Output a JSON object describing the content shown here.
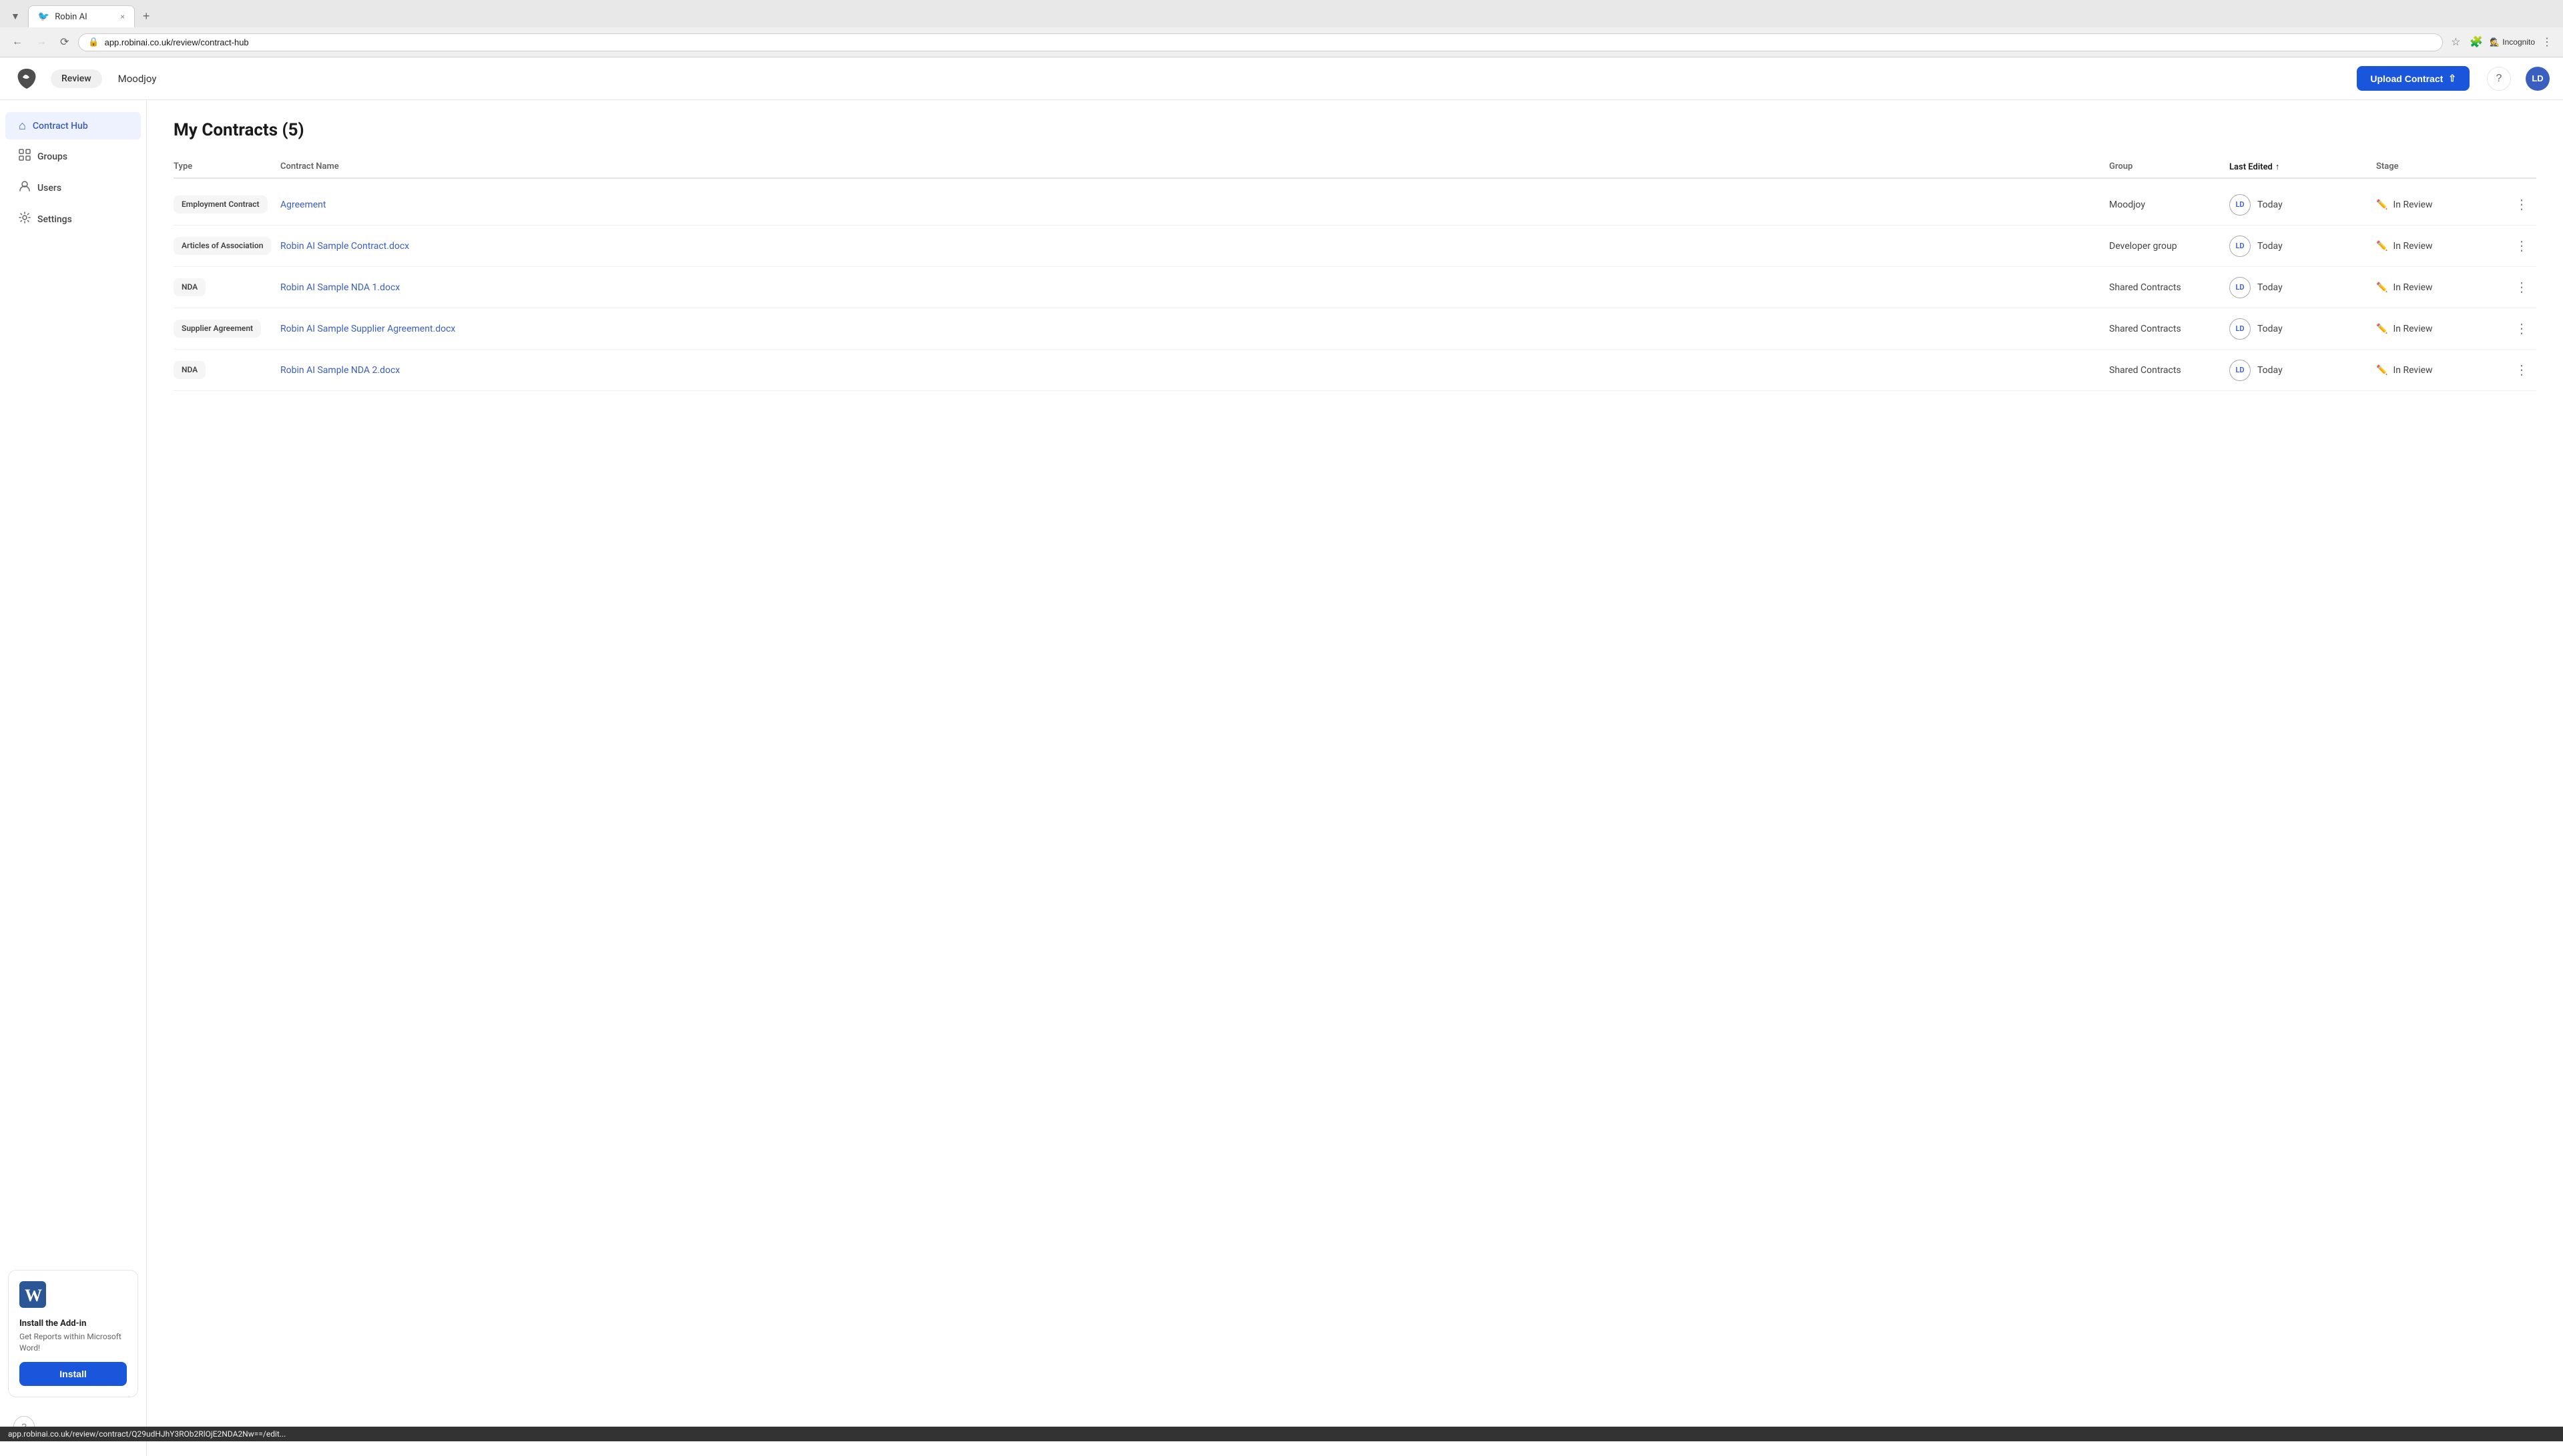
{
  "browser": {
    "tab_label": "Robin AI",
    "tab_close": "×",
    "new_tab": "+",
    "url": "app.robinai.co.uk/review/contract-hub",
    "incognito_label": "Incognito",
    "back_disabled": false,
    "forward_disabled": true
  },
  "header": {
    "review_badge": "Review",
    "org_name": "Moodjoy",
    "upload_button": "Upload Contract",
    "help_icon": "?",
    "avatar_initials": "LD"
  },
  "sidebar": {
    "items": [
      {
        "id": "contract-hub",
        "label": "Contract Hub",
        "active": true
      },
      {
        "id": "groups",
        "label": "Groups",
        "active": false
      },
      {
        "id": "users",
        "label": "Users",
        "active": false
      },
      {
        "id": "settings",
        "label": "Settings",
        "active": false
      }
    ],
    "install_card": {
      "title": "Install the Add-in",
      "description": "Get Reports within Microsoft Word!",
      "button_label": "Install"
    }
  },
  "main": {
    "page_title": "My Contracts (5)",
    "table": {
      "columns": [
        "Type",
        "Contract Name",
        "Group",
        "Last Edited",
        "Stage"
      ],
      "sort_column": "Last Edited",
      "rows": [
        {
          "type": "Employment Contract",
          "name": "Agreement",
          "group": "Moodjoy",
          "avatar": "LD",
          "edited": "Today",
          "stage": "In Review",
          "link": "app.robinai.co.uk/review/contract/Q29udHJhY3ROb2RlOjE2NDA2Nw==/edit..."
        },
        {
          "type": "Articles of Association",
          "name": "Robin AI Sample Contract.docx",
          "group": "Developer group",
          "avatar": "LD",
          "edited": "Today",
          "stage": "In Review"
        },
        {
          "type": "NDA",
          "name": "Robin AI Sample NDA 1.docx",
          "group": "Shared Contracts",
          "avatar": "LD",
          "edited": "Today",
          "stage": "In Review"
        },
        {
          "type": "Supplier Agreement",
          "name": "Robin AI Sample Supplier Agreement.docx",
          "group": "Shared Contracts",
          "avatar": "LD",
          "edited": "Today",
          "stage": "In Review"
        },
        {
          "type": "NDA",
          "name": "Robin AI Sample NDA 2.docx",
          "group": "Shared Contracts",
          "avatar": "LD",
          "edited": "Today",
          "stage": "In Review"
        }
      ]
    }
  },
  "status_bar": {
    "url": "app.robinai.co.uk/review/contract/Q29udHJhY3ROb2RlOjE2NDA2Nw==/edit..."
  },
  "colors": {
    "accent": "#1a56db",
    "avatar_bg": "#3b5fc0",
    "link": "#3b5fc0"
  }
}
